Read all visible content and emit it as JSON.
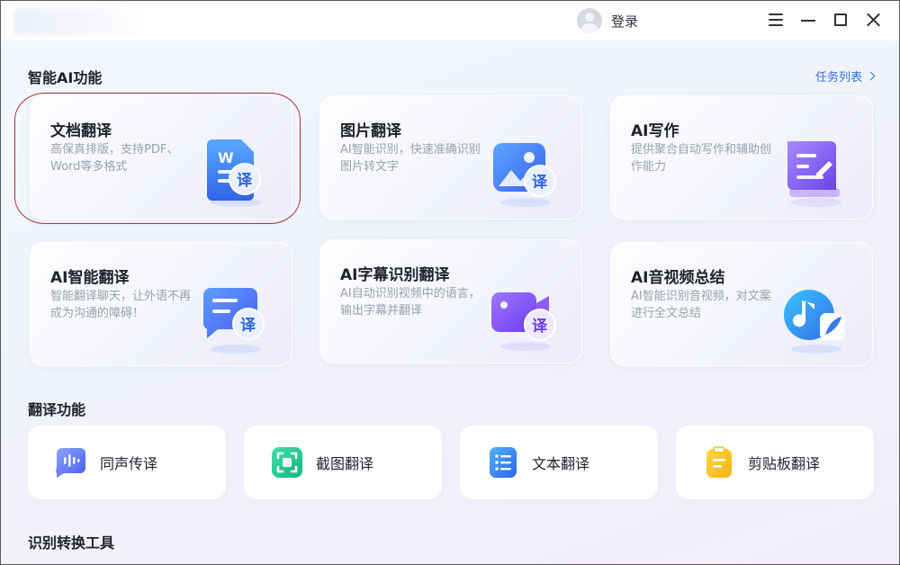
{
  "titlebar": {
    "login_label": "登录"
  },
  "sections": {
    "ai_title": "智能AI功能",
    "task_list_label": "任务列表",
    "translate_title": "翻译功能",
    "convert_title": "识别转换工具"
  },
  "cards": [
    {
      "title": "文档翻译",
      "desc": "高保真排版，支持PDF、Word等多格式",
      "icon": "document-translate-icon"
    },
    {
      "title": "图片翻译",
      "desc": "AI智能识别，快速准确识别图片转文字",
      "icon": "image-translate-icon"
    },
    {
      "title": "AI写作",
      "desc": "提供聚合自动写作和辅助创作能力",
      "icon": "ai-writing-icon"
    },
    {
      "title": "AI智能翻译",
      "desc": "智能翻译聊天，让外语不再成为沟通的障碍！",
      "icon": "chat-translate-icon"
    },
    {
      "title": "AI字幕识别翻译",
      "desc": "AI自动识别视频中的语言，输出字幕并翻译",
      "icon": "subtitle-translate-icon"
    },
    {
      "title": "AI音视频总结",
      "desc": "AI智能识别音视频，对文案进行全文总结",
      "icon": "av-summary-icon"
    }
  ],
  "tools": [
    {
      "label": "同声传译",
      "icon": "voice-interpret-icon"
    },
    {
      "label": "截图翻译",
      "icon": "screenshot-translate-icon"
    },
    {
      "label": "文本翻译",
      "icon": "text-translate-icon"
    },
    {
      "label": "剪贴板翻译",
      "icon": "clipboard-translate-icon"
    }
  ],
  "colors": {
    "accent": "#2f6fe3",
    "highlight": "#a8353a"
  }
}
